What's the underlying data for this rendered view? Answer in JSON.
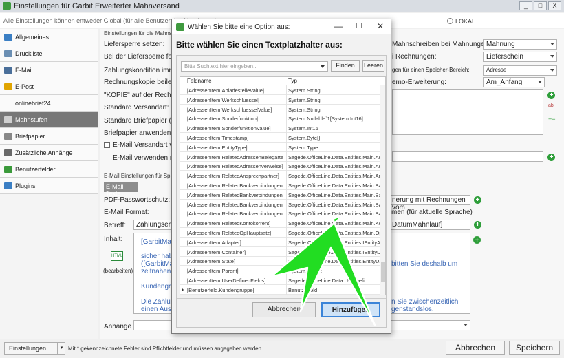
{
  "window": {
    "title": "Einstellungen für Garbit Erweiterter Mahnversand",
    "buttons": [
      "_",
      "□",
      "X"
    ]
  },
  "infobar": {
    "text": "Alle Einstellungen können entweder Global (für alle Benutzer des Mandanten) ...",
    "radio_right": "LOKAL"
  },
  "sidebar": {
    "items": [
      {
        "label": "Allgemeines",
        "icon": "settings-icon",
        "color": "#3b7fc4"
      },
      {
        "label": "Druckliste",
        "icon": "printer-icon",
        "color": "#6b8fb3"
      },
      {
        "label": "E-Mail",
        "icon": "mail-icon",
        "color": "#4a6f9a"
      },
      {
        "label": "E-Post",
        "icon": "epost-icon",
        "color": "#e0a400"
      },
      {
        "label": "onlinebrief24",
        "icon": "",
        "color": ""
      },
      {
        "label": "Mahnstufen",
        "icon": "steps-icon",
        "color": "#cfcfcf"
      },
      {
        "label": "Briefpapier",
        "icon": "paper-icon",
        "color": "#888"
      },
      {
        "label": "Zusätzliche Anhänge",
        "icon": "attachment-icon",
        "color": "#6a6a6a"
      },
      {
        "label": "Benutzerfelder",
        "icon": "userfields-icon",
        "color": "#3b9a3b"
      },
      {
        "label": "Plugins",
        "icon": "plugin-icon",
        "color": "#3b7fc4"
      }
    ]
  },
  "main": {
    "group1_title": "Einstellungen für die Mahnstufe",
    "labels_left": [
      "Liefersperre setzen:",
      "Bei der Liefersperre folge",
      "Zahlungskondition immer",
      "Rechnungskopie beilege",
      "\"KOPIE\" auf der Rechnung",
      "Standard Versandart:",
      "Standard Briefpapier (als",
      "Briefpapier anwenden an",
      "E-Mail Versandart ver",
      "E-Mail verwenden mit"
    ],
    "labels_right": [
      "Mahnschreiben bei Mahnungen:",
      "i Rechnungen:",
      "gen für einen Speicher-Bereich:",
      "emo-Erweiterung:"
    ],
    "combos_right": [
      "Mahnung",
      "Lieferschein",
      "Adresse",
      "Am_Anfang"
    ],
    "group2_title": "E-Mail Einstellungen für Sprach",
    "tab": "E-Mail Texte",
    "email_labels": [
      "PDF-Passwortschutz:",
      "E-Mail Format:",
      "Betreff:",
      "Inhalt:",
      "Anhänge"
    ],
    "email_right_texts": [
      "nerung mit Rechnungen vom",
      "men (für aktuelle Sprache)",
      "DatumMahnlauf]"
    ],
    "betreff_value": "Zahlungserrin",
    "html_label": "HTML",
    "html_edit": "(bearbeiten)",
    "content_lines": [
      "[GarbitMa",
      "sicher hab",
      "([GarbitMa",
      "zeitnahen",
      "Kundengru",
      "Die Zahlun",
      "einen Ausg"
    ],
    "content_right_lines": [
      "bitten Sie deshalb um",
      "n Sie zwischenzeitlich",
      "genstandslos."
    ]
  },
  "footer": {
    "settings_button": "Einstellungen ...",
    "note": "Mit * gekennzeichnete Fehler sind Pflichtfelder und müssen angegeben werden.",
    "cancel": "Abbrechen",
    "save": "Speichern"
  },
  "dialog": {
    "title": "Wählen Sie bitte eine Option aus:",
    "heading": "Bitte wählen Sie einen Textplatzhalter aus:",
    "search_placeholder": "Bitte Suchtext hier eingeben...",
    "find_button": "Finden",
    "clear_button": "Leeren",
    "col_field": "Feldname",
    "col_type": "Typ",
    "rows": [
      {
        "field": "[AdressenItem.AbladestelleValue]",
        "type": "System.String"
      },
      {
        "field": "[AdressenItem.Werkschluessel]",
        "type": "System.String"
      },
      {
        "field": "[AdressenItem.WerkschluesselValue]",
        "type": "System.String"
      },
      {
        "field": "[AdressenItem.Sonderfunktion]",
        "type": "System.Nullable`1[System.Int16]"
      },
      {
        "field": "[AdressenItem.SonderfunktionValue]",
        "type": "System.Int16"
      },
      {
        "field": "[AdressenItem.Timestamp]",
        "type": "System.Byte[]"
      },
      {
        "field": "[AdressenItem.EntityType]",
        "type": "System.Type"
      },
      {
        "field": "[AdressenItem.RelatedAdressenBelegarte...",
        "type": "Sagede.OfficeLine.Data.Entities.Main.Adr..."
      },
      {
        "field": "[AdressenItem.RelatedAdressenverweise]",
        "type": "Sagede.OfficeLine.Data.Entities.Main.Adr..."
      },
      {
        "field": "[AdressenItem.RelatedAnsprechpartner]",
        "type": "Sagede.OfficeLine.Data.Entities.Main.Ans..."
      },
      {
        "field": "[AdressenItem.RelatedBankverbindungenA]",
        "type": "Sagede.OfficeLine.Data.Entities.Main.Ban..."
      },
      {
        "field": "[AdressenItem.RelatedBankverbindungen...",
        "type": "Sagede.OfficeLine.Data.Entities.Main.Ban..."
      },
      {
        "field": "[AdressenItem.RelatedBankverbindungenD]",
        "type": "Sagede.OfficeLine.Data.Entities.Main.Ban..."
      },
      {
        "field": "[AdressenItem.RelatedBankverbindungenL]",
        "type": "Sagede.OfficeLine.Data.Entities.Main.Ban..."
      },
      {
        "field": "[AdressenItem.RelatedKontokorrent]",
        "type": "Sagede.OfficeLine.Data.Entities.Main.Kon..."
      },
      {
        "field": "[AdressenItem.RelatedOpHauptsatz]",
        "type": "Sagede.OfficeLine.Data.Entities.Main.Op..."
      },
      {
        "field": "[AdressenItem.Adapter]",
        "type": "Sagede.OfficeLine.Data.Entities.IEntityAd..."
      },
      {
        "field": "[AdressenItem.Container]",
        "type": "Sagede.OfficeLine.Data.Entities.IEntityDa..."
      },
      {
        "field": "[AdressenItem.State]",
        "type": "Sagede.OfficeLine.Data.Entities.EntityDat..."
      },
      {
        "field": "[AdressenItem.Parent]",
        "type": "System.Object"
      },
      {
        "field": "[AdressenItem.UserDefinedFields]",
        "type": "Sagede.OfficeLine.Data.UserDefi..."
      },
      {
        "field": "[Benutzerfeld.Kundengruppe]",
        "type": "Benutzerfeld"
      }
    ],
    "cancel_button": "Abbrechen",
    "add_button": "Hinzufügen"
  },
  "colors": {
    "accent_arrow": "#22dd22",
    "primary_button_border": "#3b84d8",
    "sidebar_active": "#777777",
    "plus_green": "#2e9e3a"
  }
}
